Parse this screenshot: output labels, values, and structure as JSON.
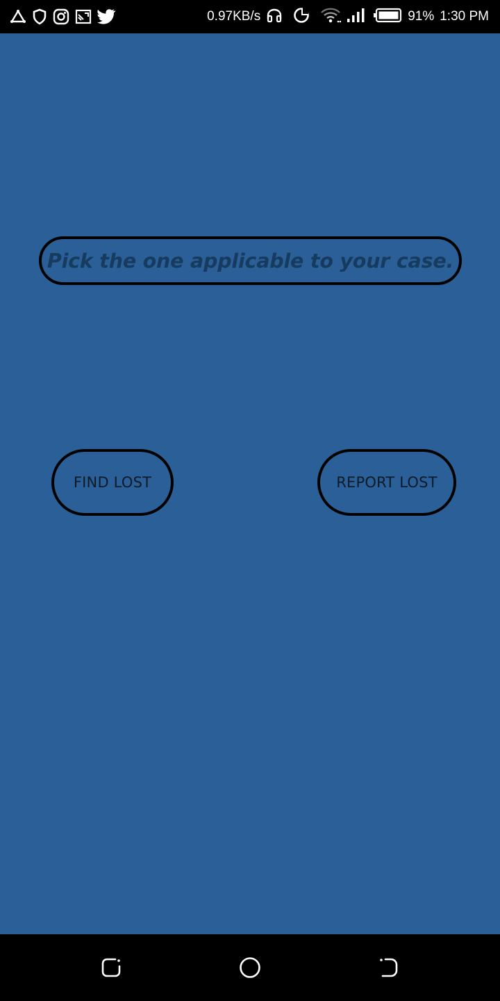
{
  "status_bar": {
    "left_icons": [
      "triangle-icon",
      "shield-icon",
      "instagram-icon",
      "screencast-icon",
      "twitter-icon"
    ],
    "network_speed": "0.97KB/s",
    "right_icons": [
      "headphones-icon",
      "data-saver-icon",
      "wifi-icon",
      "signal-icon",
      "battery-icon"
    ],
    "battery_percent": "91%",
    "time": "1:30 PM"
  },
  "main": {
    "prompt": "Pick the one applicable to your case.",
    "find_lost_label": "FIND LOST",
    "report_lost_label": "REPORT LOST"
  },
  "nav_bar": {
    "buttons": [
      "recent-apps-icon",
      "home-icon",
      "back-icon"
    ]
  },
  "colors": {
    "background": "#2a6097",
    "prompt_text": "#173a5f",
    "button_text": "#0e1a28",
    "border": "#000000"
  }
}
